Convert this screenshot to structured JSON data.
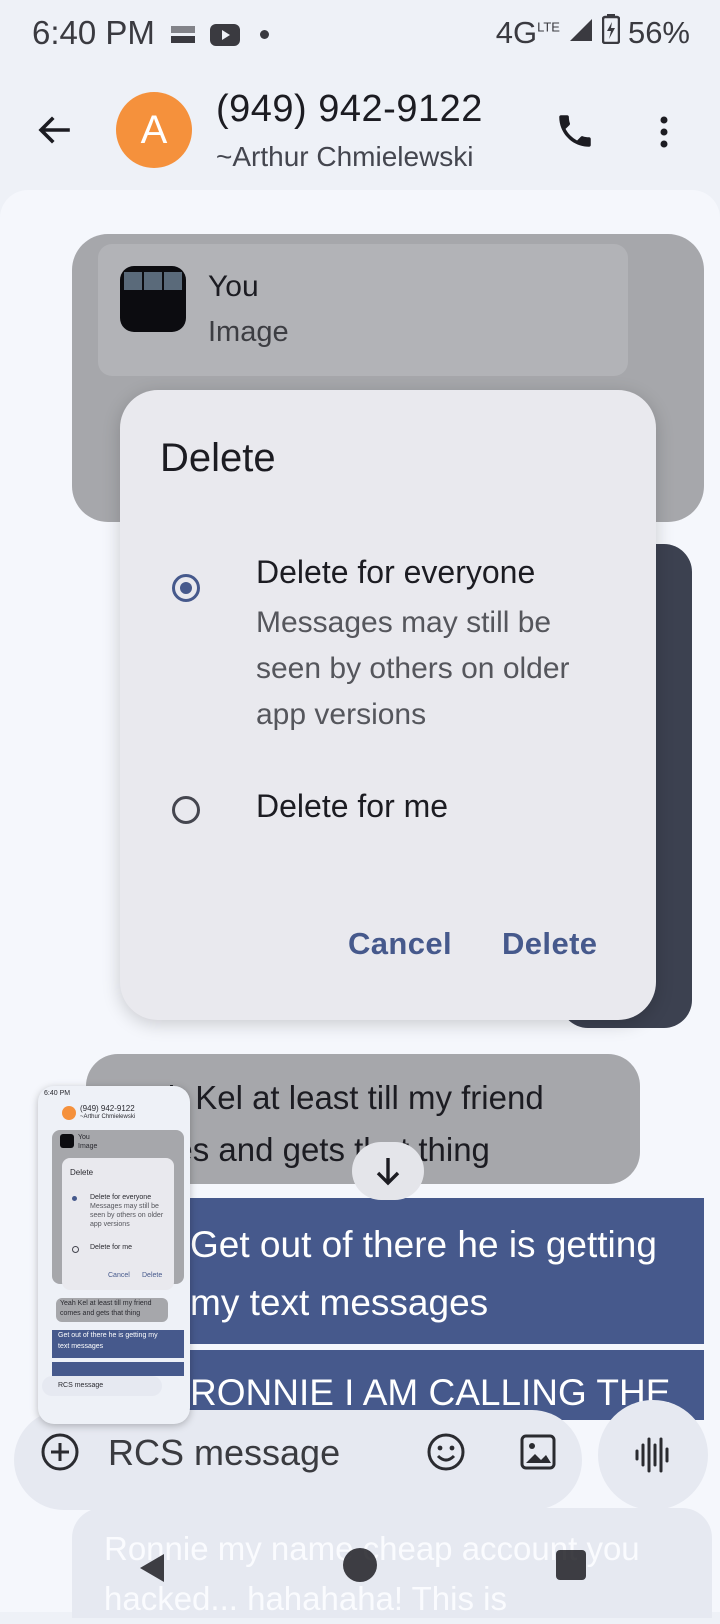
{
  "status_bar": {
    "time": "6:40 PM",
    "network": "4G",
    "network_sup": "LTE",
    "battery": "56%"
  },
  "header": {
    "avatar_letter": "A",
    "title": "(949) 942-9122",
    "subtitle": "~Arthur Chmielewski"
  },
  "conversation": {
    "reply_sender": "You",
    "reply_type": "Image",
    "message_in_2": "Yeah Kel at least till my friend comes and gets that thing",
    "message_out_1": "Get out of there he is getting my text messages",
    "message_out_2": "RONNIE I AM CALLING THE",
    "message_out_3": "Ronnie my name cheap account you hacked... hahahaha! This is"
  },
  "dialog": {
    "title": "Delete",
    "option_1_label": "Delete for everyone",
    "option_1_description": "Messages may still be seen by others on older app versions",
    "option_2_label": "Delete for me",
    "cancel_label": "Cancel",
    "delete_label": "Delete",
    "selected_option": 1
  },
  "compose": {
    "placeholder": "RCS message"
  },
  "thumbnail": {
    "time": "6:40 PM",
    "title": "(949) 942-9122",
    "subtitle": "~Arthur Chmielewski",
    "reply_sender": "You",
    "reply_type": "Image",
    "dialog_title": "Delete",
    "opt1": "Delete for everyone",
    "opt1_sub_1": "Messages may still be",
    "opt1_sub_2": "seen by others on older",
    "opt1_sub_3": "app versions",
    "opt2": "Delete for me",
    "cancel": "Cancel",
    "delete": "Delete",
    "msg_in_1": "Yeah Kel at least till my friend",
    "msg_in_2": "comes and gets that thing",
    "msg_out_1": "Get out of there he is getting my",
    "msg_out_2": "text messages",
    "compose": "RCS message"
  },
  "colors": {
    "accent": "#46598c",
    "avatar": "#f5913c",
    "scrim_bubble": "#a6a7ab"
  }
}
